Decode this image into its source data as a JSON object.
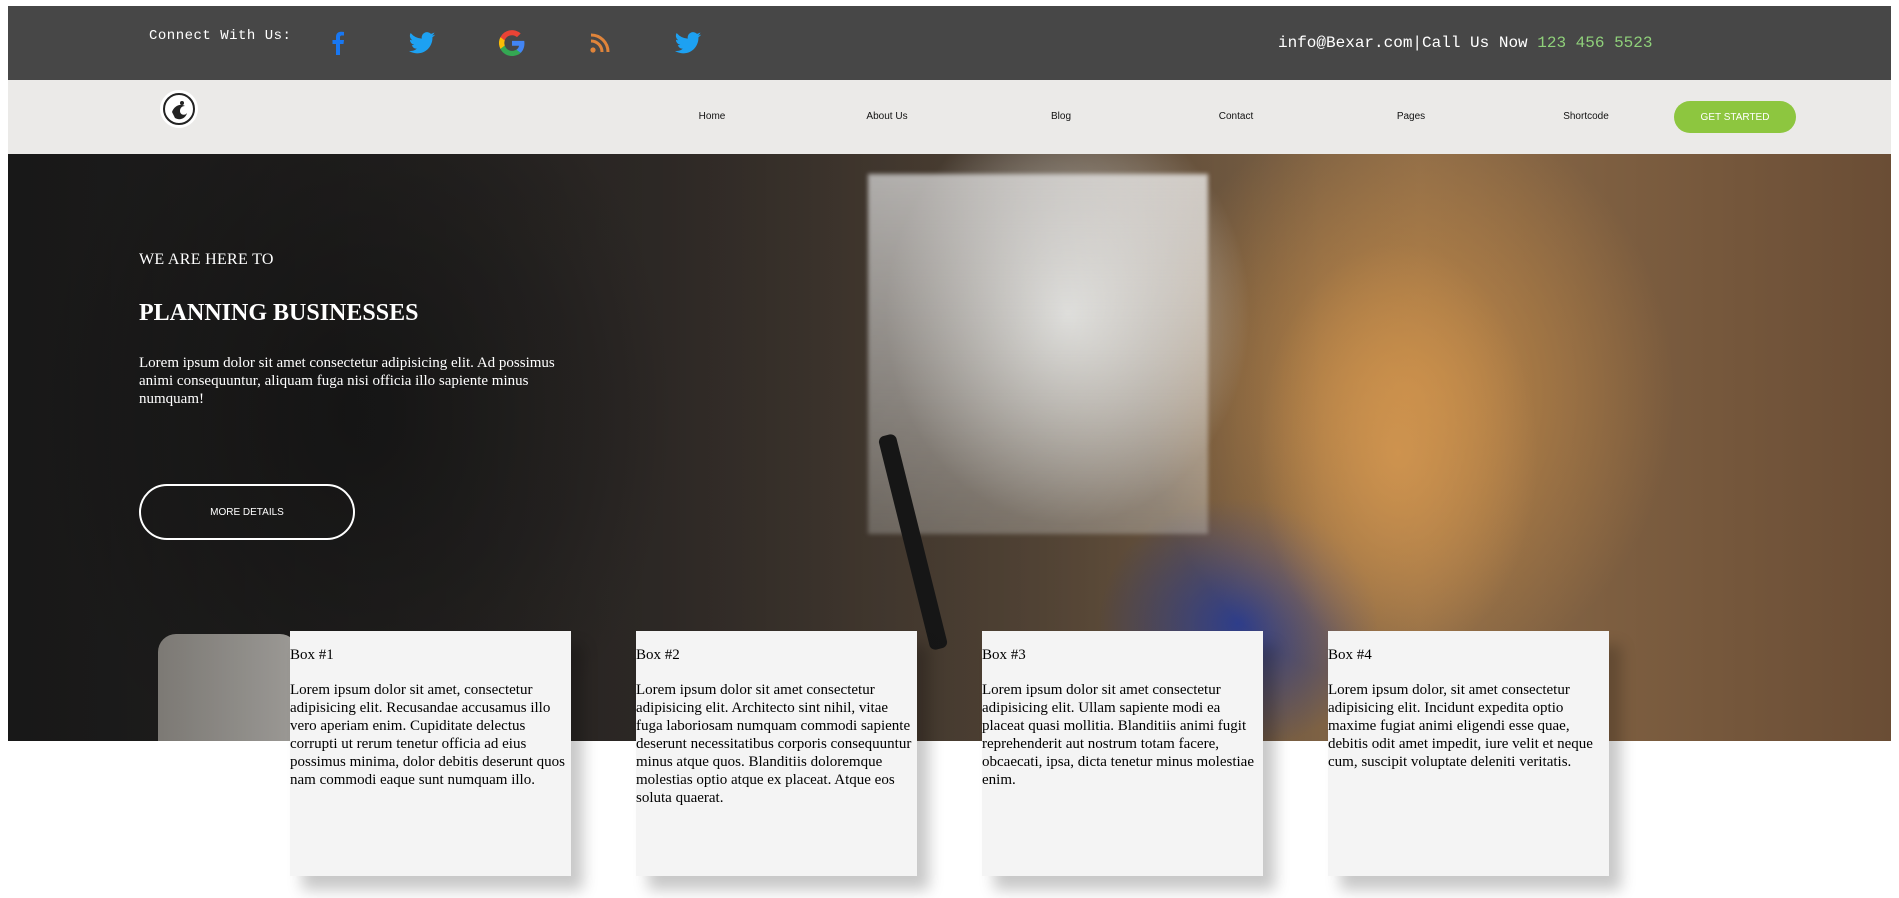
{
  "topbar": {
    "connect_label": "Connect With Us:",
    "social": [
      {
        "icon": "facebook-icon",
        "color": "#1877f2"
      },
      {
        "icon": "twitter-icon",
        "color": "#1da1f2"
      },
      {
        "icon": "google-icon",
        "color": "#4285f4"
      },
      {
        "icon": "rss-icon",
        "color": "#e0843a"
      },
      {
        "icon": "twitter-icon",
        "color": "#1da1f2"
      }
    ],
    "email": "info@Bexar.com",
    "separator": "|",
    "call_label": "Call Us Now",
    "phone": "123 456 5523"
  },
  "nav": {
    "logo_icon": "logo-icon",
    "items": [
      "Home",
      "About Us",
      "Blog",
      "Contact",
      "Pages",
      "Shortcode"
    ],
    "cta": "GET STARTED",
    "accent": "#8dc63f"
  },
  "hero": {
    "kicker": "WE ARE HERE TO",
    "title": "PLANNING BUSINESSES",
    "text": "Lorem ipsum dolor sit amet consectetur adipisicing elit. Ad possimus animi consequuntur, aliquam fuga nisi officia illo sapiente minus numquam!",
    "button": "MORE DETAILS"
  },
  "boxes": [
    {
      "title": "Box #1",
      "text": "Lorem ipsum dolor sit amet, consectetur adipisicing elit. Recusandae accusamus illo vero aperiam enim. Cupiditate delectus corrupti ut rerum tenetur officia ad eius possimus minima, dolor debitis deserunt quos nam commodi eaque sunt numquam illo."
    },
    {
      "title": "Box #2",
      "text": "Lorem ipsum dolor sit amet consectetur adipisicing elit. Architecto sint nihil, vitae fuga laboriosam numquam commodi sapiente deserunt necessitatibus corporis consequuntur minus atque quos. Blanditiis doloremque molestias optio atque ex placeat. Atque eos soluta quaerat."
    },
    {
      "title": "Box #3",
      "text": "Lorem ipsum dolor sit amet consectetur adipisicing elit. Ullam sapiente modi ea placeat quasi mollitia. Blanditiis animi fugit reprehenderit aut nostrum totam facere, obcaecati, ipsa, dicta tenetur minus molestiae enim."
    },
    {
      "title": "Box #4",
      "text": "Lorem ipsum dolor, sit amet consectetur adipisicing elit. Incidunt expedita optio maxime fugiat animi eligendi esse quae, debitis odit amet impedit, iure velit et neque cum, suscipit voluptate deleniti veritatis."
    }
  ]
}
